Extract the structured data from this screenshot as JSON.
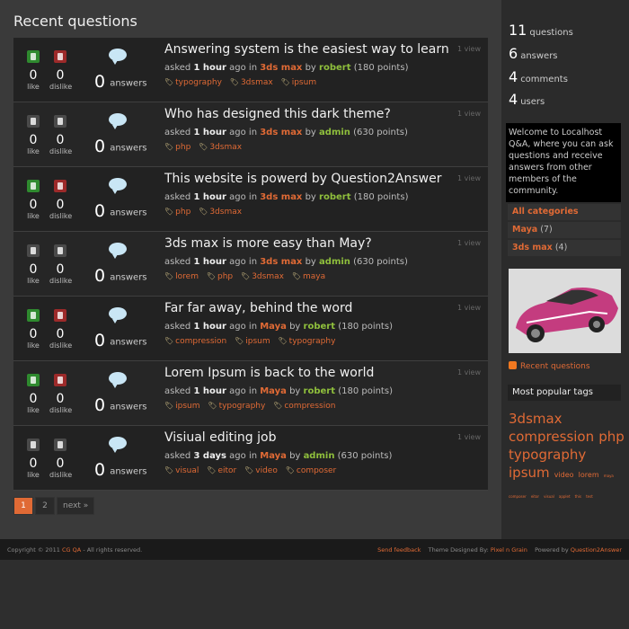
{
  "page_title": "Recent questions",
  "colors": {
    "accent": "#e06a35",
    "user": "#8fbf3c",
    "background": "#3a3a3a",
    "sidebar": "#2b2b2b"
  },
  "labels": {
    "like": "like",
    "dislike": "dislike",
    "answers": "answers",
    "asked": "asked",
    "ago_in": "ago in",
    "by": "by"
  },
  "questions": [
    {
      "title": "Answering system is the easiest way to learn",
      "likes": "0",
      "dislikes": "0",
      "answers": "0",
      "time": "1 hour",
      "category": "3ds max",
      "user": "robert",
      "points": "(180 points)",
      "views": "1 view",
      "tags": [
        "typography",
        "3dsmax",
        "ipsum"
      ],
      "voting_active": true
    },
    {
      "title": "Who has designed this dark theme?",
      "likes": "0",
      "dislikes": "0",
      "answers": "0",
      "time": "1 hour",
      "category": "3ds max",
      "user": "admin",
      "points": "(630 points)",
      "views": "1 view",
      "tags": [
        "php",
        "3dsmax"
      ],
      "voting_active": false
    },
    {
      "title": "This website is powerd by Question2Answer",
      "likes": "0",
      "dislikes": "0",
      "answers": "0",
      "time": "1 hour",
      "category": "3ds max",
      "user": "robert",
      "points": "(180 points)",
      "views": "1 view",
      "tags": [
        "php",
        "3dsmax"
      ],
      "voting_active": true
    },
    {
      "title": "3ds max is more easy than May?",
      "likes": "0",
      "dislikes": "0",
      "answers": "0",
      "time": "1 hour",
      "category": "3ds max",
      "user": "admin",
      "points": "(630 points)",
      "views": "1 view",
      "tags": [
        "lorem",
        "php",
        "3dsmax",
        "maya"
      ],
      "voting_active": false
    },
    {
      "title": "Far far away, behind the word",
      "likes": "0",
      "dislikes": "0",
      "answers": "0",
      "time": "1 hour",
      "category": "Maya",
      "user": "robert",
      "points": "(180 points)",
      "views": "1 view",
      "tags": [
        "compression",
        "ipsum",
        "typography"
      ],
      "voting_active": true
    },
    {
      "title": "Lorem Ipsum is back to the world",
      "likes": "0",
      "dislikes": "0",
      "answers": "0",
      "time": "1 hour",
      "category": "Maya",
      "user": "robert",
      "points": "(180 points)",
      "views": "1 view",
      "tags": [
        "ipsum",
        "typography",
        "compression"
      ],
      "voting_active": true
    },
    {
      "title": "Visiual editing job",
      "likes": "0",
      "dislikes": "0",
      "answers": "0",
      "time": "3 days",
      "category": "Maya",
      "user": "admin",
      "points": "(630 points)",
      "views": "1 view",
      "tags": [
        "visual",
        "eitor",
        "video",
        "composer"
      ],
      "voting_active": false
    }
  ],
  "pagination": {
    "pages": [
      "1",
      "2"
    ],
    "next": "next »",
    "current": "1"
  },
  "stats": [
    {
      "count": "11",
      "label": "questions"
    },
    {
      "count": "6",
      "label": "answers"
    },
    {
      "count": "4",
      "label": "comments"
    },
    {
      "count": "4",
      "label": "users"
    }
  ],
  "welcome": "Welcome to Localhost Q&A, where you can ask questions and receive answers from other members of the community.",
  "categories": [
    {
      "name": "All categories",
      "count": ""
    },
    {
      "name": "Maya",
      "count": "(7)"
    },
    {
      "name": "3ds max",
      "count": "(4)"
    }
  ],
  "feed_label": "Recent questions",
  "popular_tags_title": "Most popular tags",
  "tag_cloud": [
    {
      "name": "3dsmax",
      "size": "t1"
    },
    {
      "name": "compression",
      "size": "t1"
    },
    {
      "name": "php",
      "size": "t1"
    },
    {
      "name": "typography",
      "size": "t1"
    },
    {
      "name": "ipsum",
      "size": "t1"
    },
    {
      "name": "video",
      "size": "t2"
    },
    {
      "name": "lorem",
      "size": "t2"
    },
    {
      "name": "maya",
      "size": "t3"
    },
    {
      "name": "composer",
      "size": "t3"
    },
    {
      "name": "eitor",
      "size": "t3"
    },
    {
      "name": "visual",
      "size": "t3"
    },
    {
      "name": "applet",
      "size": "t3"
    },
    {
      "name": "this",
      "size": "t3"
    },
    {
      "name": "test",
      "size": "t3"
    }
  ],
  "footer": {
    "copyright_prefix": "Copyright © 2011",
    "site_name": "CG QA",
    "copyright_suffix": "- All rights reserved.",
    "feedback": "Send feedback",
    "theme_prefix": "Theme Designed By:",
    "theme_author": "Pixel n Grain",
    "powered_prefix": "Powered by",
    "powered_by": "Question2Answer"
  }
}
